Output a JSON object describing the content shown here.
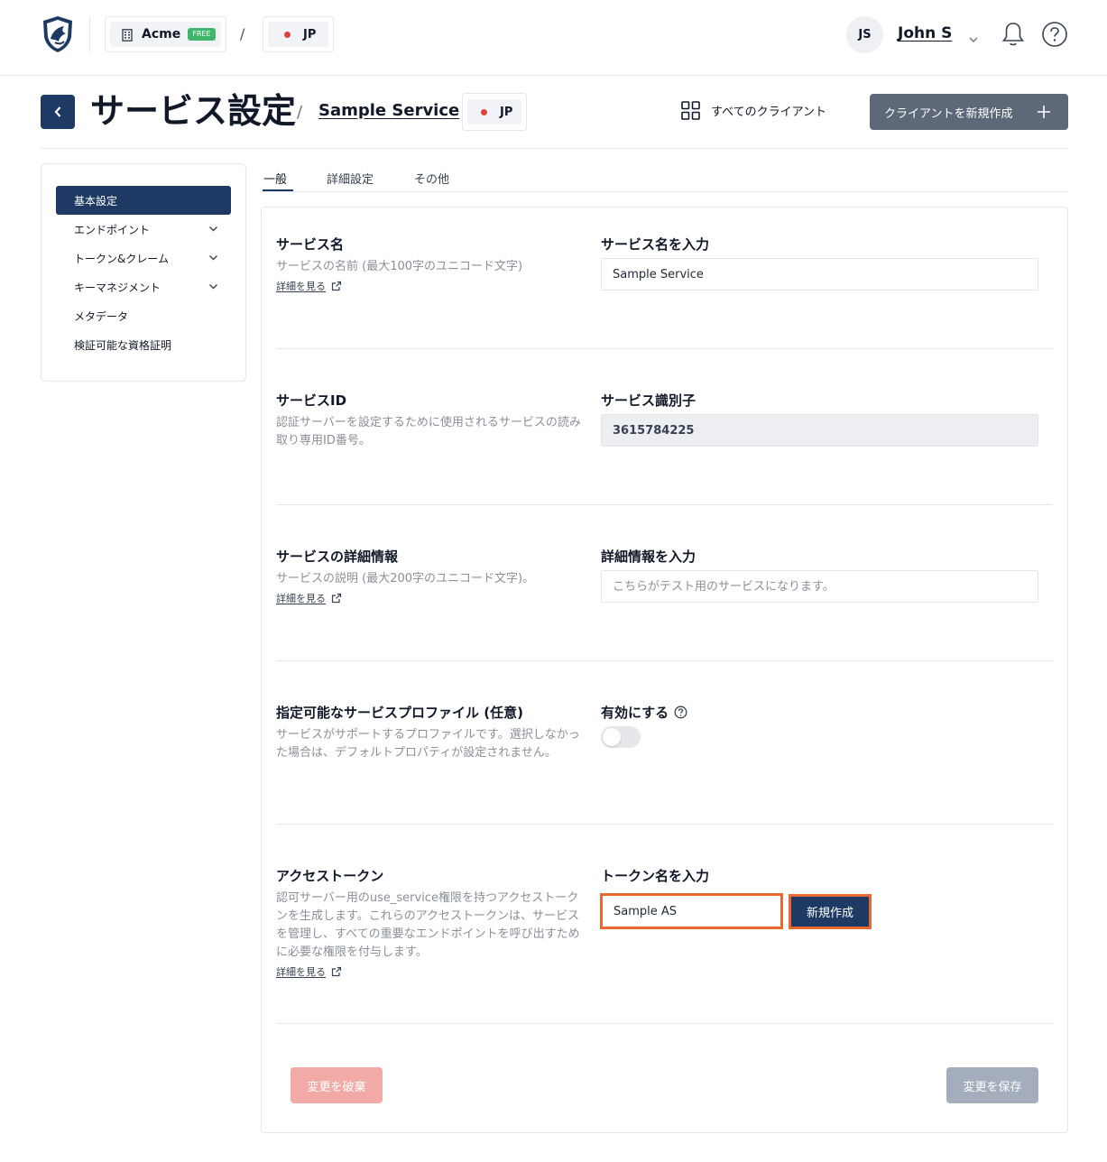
{
  "topbar": {
    "org_name": "Acme",
    "org_plan_badge": "FREE",
    "separator": "/",
    "region": "JP",
    "user_initials": "JS",
    "user_name": "John S"
  },
  "header": {
    "title": "サービス設定",
    "breadcrumb_separator": "/",
    "service_name": "Sample Service",
    "region": "JP",
    "all_clients_label": "すべてのクライアント",
    "new_client_label": "クライアントを新規作成"
  },
  "sidebar": {
    "items": [
      {
        "label": "基本設定",
        "active": true,
        "expandable": false
      },
      {
        "label": "エンドポイント",
        "active": false,
        "expandable": true
      },
      {
        "label": "トークン&クレーム",
        "active": false,
        "expandable": true
      },
      {
        "label": "キーマネジメント",
        "active": false,
        "expandable": true
      },
      {
        "label": "メタデータ",
        "active": false,
        "expandable": false
      },
      {
        "label": "検証可能な資格証明",
        "active": false,
        "expandable": false
      }
    ]
  },
  "tabs": [
    {
      "label": "一般",
      "active": true
    },
    {
      "label": "詳細設定",
      "active": false
    },
    {
      "label": "その他",
      "active": false
    }
  ],
  "sections": {
    "service_name": {
      "title": "サービス名",
      "desc": "サービスの名前 (最大100字のユニコード文字)",
      "more_link": "詳細を見る",
      "field_label": "サービス名を入力",
      "value": "Sample Service"
    },
    "service_id": {
      "title": "サービスID",
      "desc": "認証サーバーを設定するために使用されるサービスの読み取り専用ID番号。",
      "field_label": "サービス識別子",
      "value": "3615784225"
    },
    "service_details": {
      "title": "サービスの詳細情報",
      "desc": "サービスの説明 (最大200字のユニコード文字)。",
      "more_link": "詳細を見る",
      "field_label": "詳細情報を入力",
      "placeholder": "こちらがテスト用のサービスになります。"
    },
    "service_profile": {
      "title": "指定可能なサービスプロファイル (任意)",
      "desc": "サービスがサポートするプロファイルです。選択しなかった場合は、デフォルトプロパティが設定されません。",
      "field_label": "有効にする",
      "enabled": false
    },
    "access_token": {
      "title": "アクセストークン",
      "desc": "認可サーバー用のuse_service権限を持つアクセストークンを生成します。これらのアクセストークンは、サービスを管理し、すべての重要なエンドポイントを呼び出すために必要な権限を付与します。",
      "more_link": "詳細を見る",
      "field_label": "トークン名を入力",
      "value": "Sample AS",
      "create_label": "新規作成"
    }
  },
  "footer": {
    "discard_label": "変更を破棄",
    "save_label": "変更を保存"
  },
  "colors": {
    "primary": "#1e3a64",
    "highlight": "#e8692f",
    "free_badge": "#3fb76b",
    "region_dot": "#e53e3e",
    "discard": "#f2aaa6",
    "save_disabled": "#a3adbb"
  }
}
